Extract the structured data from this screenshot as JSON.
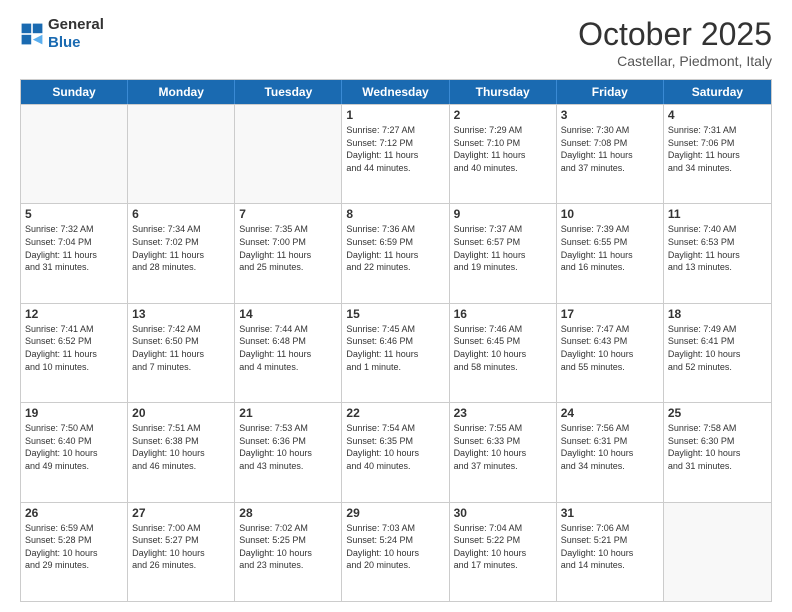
{
  "logo": {
    "general": "General",
    "blue": "Blue"
  },
  "title": "October 2025",
  "subtitle": "Castellar, Piedmont, Italy",
  "days": [
    "Sunday",
    "Monday",
    "Tuesday",
    "Wednesday",
    "Thursday",
    "Friday",
    "Saturday"
  ],
  "weeks": [
    [
      {
        "day": "",
        "info": ""
      },
      {
        "day": "",
        "info": ""
      },
      {
        "day": "",
        "info": ""
      },
      {
        "day": "1",
        "info": "Sunrise: 7:27 AM\nSunset: 7:12 PM\nDaylight: 11 hours\nand 44 minutes."
      },
      {
        "day": "2",
        "info": "Sunrise: 7:29 AM\nSunset: 7:10 PM\nDaylight: 11 hours\nand 40 minutes."
      },
      {
        "day": "3",
        "info": "Sunrise: 7:30 AM\nSunset: 7:08 PM\nDaylight: 11 hours\nand 37 minutes."
      },
      {
        "day": "4",
        "info": "Sunrise: 7:31 AM\nSunset: 7:06 PM\nDaylight: 11 hours\nand 34 minutes."
      }
    ],
    [
      {
        "day": "5",
        "info": "Sunrise: 7:32 AM\nSunset: 7:04 PM\nDaylight: 11 hours\nand 31 minutes."
      },
      {
        "day": "6",
        "info": "Sunrise: 7:34 AM\nSunset: 7:02 PM\nDaylight: 11 hours\nand 28 minutes."
      },
      {
        "day": "7",
        "info": "Sunrise: 7:35 AM\nSunset: 7:00 PM\nDaylight: 11 hours\nand 25 minutes."
      },
      {
        "day": "8",
        "info": "Sunrise: 7:36 AM\nSunset: 6:59 PM\nDaylight: 11 hours\nand 22 minutes."
      },
      {
        "day": "9",
        "info": "Sunrise: 7:37 AM\nSunset: 6:57 PM\nDaylight: 11 hours\nand 19 minutes."
      },
      {
        "day": "10",
        "info": "Sunrise: 7:39 AM\nSunset: 6:55 PM\nDaylight: 11 hours\nand 16 minutes."
      },
      {
        "day": "11",
        "info": "Sunrise: 7:40 AM\nSunset: 6:53 PM\nDaylight: 11 hours\nand 13 minutes."
      }
    ],
    [
      {
        "day": "12",
        "info": "Sunrise: 7:41 AM\nSunset: 6:52 PM\nDaylight: 11 hours\nand 10 minutes."
      },
      {
        "day": "13",
        "info": "Sunrise: 7:42 AM\nSunset: 6:50 PM\nDaylight: 11 hours\nand 7 minutes."
      },
      {
        "day": "14",
        "info": "Sunrise: 7:44 AM\nSunset: 6:48 PM\nDaylight: 11 hours\nand 4 minutes."
      },
      {
        "day": "15",
        "info": "Sunrise: 7:45 AM\nSunset: 6:46 PM\nDaylight: 11 hours\nand 1 minute."
      },
      {
        "day": "16",
        "info": "Sunrise: 7:46 AM\nSunset: 6:45 PM\nDaylight: 10 hours\nand 58 minutes."
      },
      {
        "day": "17",
        "info": "Sunrise: 7:47 AM\nSunset: 6:43 PM\nDaylight: 10 hours\nand 55 minutes."
      },
      {
        "day": "18",
        "info": "Sunrise: 7:49 AM\nSunset: 6:41 PM\nDaylight: 10 hours\nand 52 minutes."
      }
    ],
    [
      {
        "day": "19",
        "info": "Sunrise: 7:50 AM\nSunset: 6:40 PM\nDaylight: 10 hours\nand 49 minutes."
      },
      {
        "day": "20",
        "info": "Sunrise: 7:51 AM\nSunset: 6:38 PM\nDaylight: 10 hours\nand 46 minutes."
      },
      {
        "day": "21",
        "info": "Sunrise: 7:53 AM\nSunset: 6:36 PM\nDaylight: 10 hours\nand 43 minutes."
      },
      {
        "day": "22",
        "info": "Sunrise: 7:54 AM\nSunset: 6:35 PM\nDaylight: 10 hours\nand 40 minutes."
      },
      {
        "day": "23",
        "info": "Sunrise: 7:55 AM\nSunset: 6:33 PM\nDaylight: 10 hours\nand 37 minutes."
      },
      {
        "day": "24",
        "info": "Sunrise: 7:56 AM\nSunset: 6:31 PM\nDaylight: 10 hours\nand 34 minutes."
      },
      {
        "day": "25",
        "info": "Sunrise: 7:58 AM\nSunset: 6:30 PM\nDaylight: 10 hours\nand 31 minutes."
      }
    ],
    [
      {
        "day": "26",
        "info": "Sunrise: 6:59 AM\nSunset: 5:28 PM\nDaylight: 10 hours\nand 29 minutes."
      },
      {
        "day": "27",
        "info": "Sunrise: 7:00 AM\nSunset: 5:27 PM\nDaylight: 10 hours\nand 26 minutes."
      },
      {
        "day": "28",
        "info": "Sunrise: 7:02 AM\nSunset: 5:25 PM\nDaylight: 10 hours\nand 23 minutes."
      },
      {
        "day": "29",
        "info": "Sunrise: 7:03 AM\nSunset: 5:24 PM\nDaylight: 10 hours\nand 20 minutes."
      },
      {
        "day": "30",
        "info": "Sunrise: 7:04 AM\nSunset: 5:22 PM\nDaylight: 10 hours\nand 17 minutes."
      },
      {
        "day": "31",
        "info": "Sunrise: 7:06 AM\nSunset: 5:21 PM\nDaylight: 10 hours\nand 14 minutes."
      },
      {
        "day": "",
        "info": ""
      }
    ]
  ]
}
